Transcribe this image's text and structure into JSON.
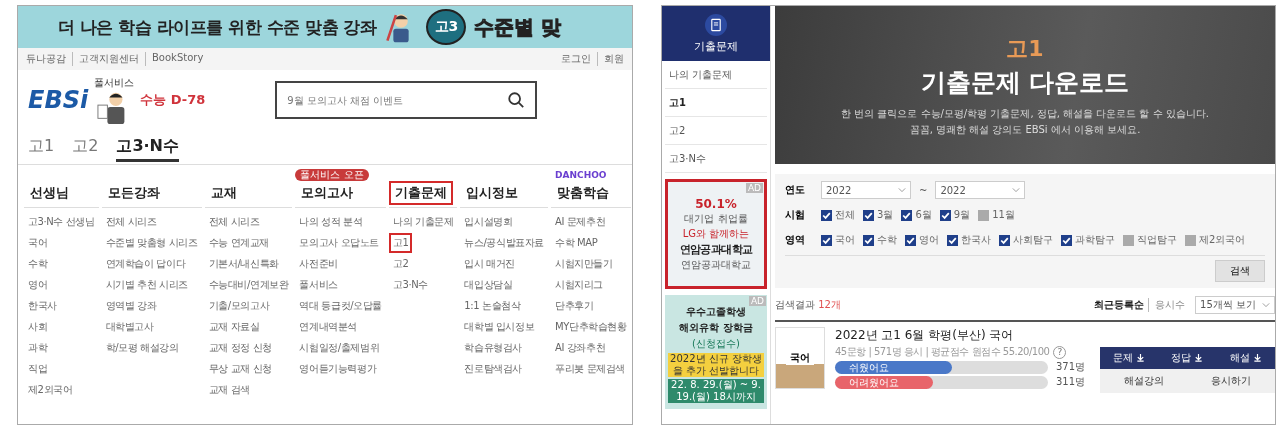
{
  "left": {
    "banner": {
      "text": "더 나은 학습 라이프를 위한 수준 맞춤 강좌",
      "badge": "고3",
      "cut_text": "수준별 맞"
    },
    "utility_links": [
      "듀나공감",
      "고객지원센터",
      "BookStory"
    ],
    "account_links": [
      "로그인",
      "회원"
    ],
    "logo": "EBSi",
    "mascot_label": "풀서비스",
    "dday": "수능 D-78",
    "search": {
      "placeholder": "9월 모의고사 채점 이벤트"
    },
    "grade_tabs": [
      {
        "label": "고1",
        "selected": false
      },
      {
        "label": "고2",
        "selected": false
      },
      {
        "label": "고3·N수",
        "selected": true
      }
    ],
    "nav": [
      {
        "label": "선생님",
        "highlighted": false,
        "links": [
          {
            "label": "고3·N수 선생님",
            "highlighted": false
          },
          {
            "label": "국어",
            "highlighted": false
          },
          {
            "label": "수학",
            "highlighted": false
          },
          {
            "label": "영어",
            "highlighted": false
          },
          {
            "label": "한국사",
            "highlighted": false
          },
          {
            "label": "사회",
            "highlighted": false
          },
          {
            "label": "과학",
            "highlighted": false
          },
          {
            "label": "직업",
            "highlighted": false
          },
          {
            "label": "제2외국어",
            "highlighted": false
          }
        ]
      },
      {
        "label": "모든강좌",
        "highlighted": false,
        "links": [
          {
            "label": "전체 시리즈",
            "highlighted": false
          },
          {
            "label": "수준별 맞춤형 시리즈",
            "highlighted": false
          },
          {
            "label": "연계학습이 답이다",
            "highlighted": false
          },
          {
            "label": "시기별 추천 시리즈",
            "highlighted": false
          },
          {
            "label": "영역별 강좌",
            "highlighted": false
          },
          {
            "label": "대학별고사",
            "highlighted": false
          },
          {
            "label": "학/모평 해설강의",
            "highlighted": false
          }
        ]
      },
      {
        "label": "교재",
        "highlighted": false,
        "links": [
          {
            "label": "전체 시리즈",
            "highlighted": false
          },
          {
            "label": "수능 연계교재",
            "highlighted": false
          },
          {
            "label": "기본서/내신특화",
            "highlighted": false
          },
          {
            "label": "수능대비/연계보완",
            "highlighted": false
          },
          {
            "label": "기출/모의고사",
            "highlighted": false
          },
          {
            "label": "교재 자료실",
            "highlighted": false
          },
          {
            "label": "교재 정정 신청",
            "highlighted": false
          },
          {
            "label": "무상 교재 신청",
            "highlighted": false
          },
          {
            "label": "교재 검색",
            "highlighted": false
          }
        ]
      },
      {
        "label": "모의고사",
        "highlighted": false,
        "badge": "풀서비스 오픈",
        "links": [
          {
            "label": "나의 성적 분석",
            "highlighted": false
          },
          {
            "label": "모의고사 오답노트",
            "highlighted": false
          },
          {
            "label": "사전준비",
            "highlighted": false
          },
          {
            "label": "풀서비스",
            "highlighted": false
          },
          {
            "label": "역대 등급컷/오답률",
            "highlighted": false
          },
          {
            "label": "연계내역분석",
            "highlighted": false
          },
          {
            "label": "시험일정/출제범위",
            "highlighted": false
          },
          {
            "label": "영어듣기능력평가",
            "highlighted": false
          }
        ]
      },
      {
        "label": "기출문제",
        "highlighted": true,
        "links": [
          {
            "label": "나의 기출문제",
            "highlighted": false
          },
          {
            "label": "고1",
            "highlighted": true
          },
          {
            "label": "고2",
            "highlighted": false
          },
          {
            "label": "고3·N수",
            "highlighted": false
          }
        ]
      },
      {
        "label": "입시정보",
        "highlighted": false,
        "links": [
          {
            "label": "입시설명회",
            "highlighted": false
          },
          {
            "label": "뉴스/공식발표자료",
            "highlighted": false
          },
          {
            "label": "입시 매거진",
            "highlighted": false
          },
          {
            "label": "대입상담실",
            "highlighted": false
          },
          {
            "label": "1:1 논술첨삭",
            "highlighted": false
          },
          {
            "label": "대학별 입시정보",
            "highlighted": false
          },
          {
            "label": "학습유형검사",
            "highlighted": false
          },
          {
            "label": "진로탐색검사",
            "highlighted": false
          }
        ]
      },
      {
        "label": "맞춤학습",
        "highlighted": false,
        "tag": "DANCHOO",
        "links": [
          {
            "label": "AI 문제추천",
            "highlighted": false
          },
          {
            "label": "수학 MAP",
            "highlighted": false
          },
          {
            "label": "시험지만들기",
            "highlighted": false
          },
          {
            "label": "시험지리그",
            "highlighted": false
          },
          {
            "label": "단추후기",
            "highlighted": false
          },
          {
            "label": "MY단추학습현황",
            "highlighted": false
          },
          {
            "label": "AI 강좌추천",
            "highlighted": false
          },
          {
            "label": "푸리봇 문제검색",
            "highlighted": false
          }
        ]
      }
    ]
  },
  "right": {
    "sidebar": {
      "title": "기출문제",
      "items": [
        {
          "label": "나의 기출문제",
          "selected": false
        },
        {
          "label": "고1",
          "selected": true
        },
        {
          "label": "고2",
          "selected": false
        },
        {
          "label": "고3·N수",
          "selected": false
        }
      ],
      "ads": [
        {
          "kind": "college",
          "ad_label": "AD",
          "texts": [
            "50.1%",
            "대기업 취업률",
            "LG와 함께하는",
            "연암공과대학교",
            "연암공과대학교"
          ]
        },
        {
          "kind": "scholarship",
          "ad_label": "AD",
          "texts": [
            "우수고졸학생",
            "해외유학 장학금",
            "(신청접수)",
            "2022년 신규 장학생을 추가 선발합니다",
            "22. 8. 29.(월) ~ 9. 19.(월) 18시까지"
          ]
        }
      ]
    },
    "hero": {
      "grade": "고1",
      "title": "기출문제 다운로드",
      "lines": [
        "한 번의 클릭으로 수능/모평/학평 기출문제, 정답, 해설을 다운로드 할 수 있습니다.",
        "꼼꼼, 명쾌한 해설 강의도 EBSi 에서 이용해 보세요."
      ]
    },
    "filter": {
      "year_label": "연도",
      "year_from": "2022",
      "year_separator": "~",
      "year_to": "2022",
      "exam_label": "시험",
      "exams": [
        {
          "label": "전체",
          "checked": true
        },
        {
          "label": "3월",
          "checked": true
        },
        {
          "label": "6월",
          "checked": true
        },
        {
          "label": "9월",
          "checked": true
        },
        {
          "label": "11월",
          "checked": false
        }
      ],
      "area_label": "영역",
      "areas": [
        {
          "label": "국어",
          "checked": true
        },
        {
          "label": "수학",
          "checked": true
        },
        {
          "label": "영어",
          "checked": true
        },
        {
          "label": "한국사",
          "checked": true
        },
        {
          "label": "사회탐구",
          "checked": true
        },
        {
          "label": "과학탐구",
          "checked": true
        },
        {
          "label": "직업탐구",
          "checked": false
        },
        {
          "label": "제2외국어",
          "checked": false
        }
      ],
      "search_button": "검색"
    },
    "results": {
      "label": "검색결과",
      "count": "12개",
      "sort": [
        {
          "label": "최근등록순",
          "selected": true
        },
        {
          "label": "응시수",
          "selected": false
        }
      ],
      "page_size": "15개씩 보기"
    },
    "item": {
      "thumb_label": "국어",
      "title": "2022년 고1 6월 학평(부산) 국어",
      "meta": "45문항 | 571명 응시 | 평균점수 원점수 55.20/100",
      "help": "?",
      "ratings": [
        {
          "label": "쉬웠어요",
          "level": 0.55,
          "count": "371명",
          "color": "#4a78c8"
        },
        {
          "label": "어려웠어요",
          "level": 0.46,
          "count": "311명",
          "color": "#e8646a"
        }
      ],
      "downloads": [
        "문제",
        "정답",
        "해설"
      ],
      "actions": [
        "해설강의",
        "응시하기"
      ]
    }
  }
}
